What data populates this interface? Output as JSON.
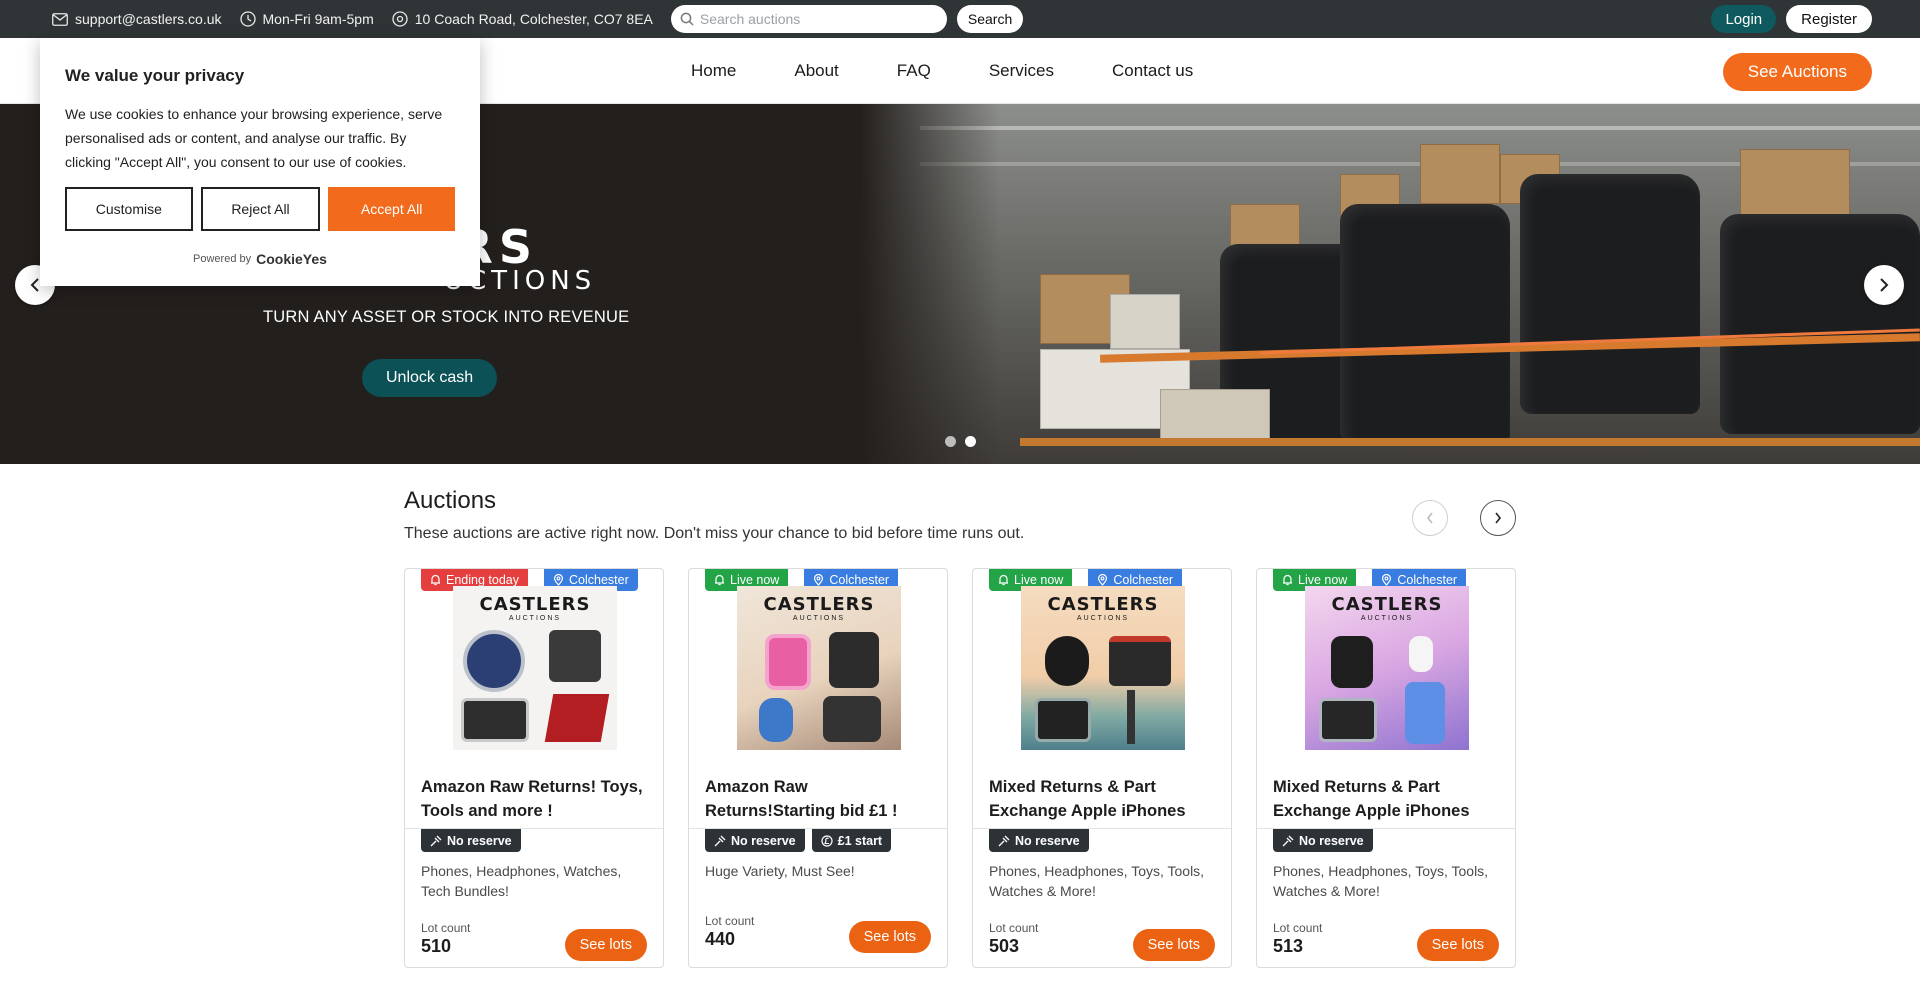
{
  "topbar": {
    "email": "support@castlers.co.uk",
    "hours": "Mon-Fri 9am-5pm",
    "address": "10 Coach Road, Colchester, CO7 8EA",
    "search_placeholder": "Search auctions",
    "search_button": "Search",
    "login": "Login",
    "register": "Register"
  },
  "nav": {
    "links": [
      "Home",
      "About",
      "FAQ",
      "Services",
      "Contact us"
    ],
    "cta": "See Auctions"
  },
  "hero": {
    "logo_main": "ERS",
    "logo_sub": "UCTIONS",
    "tagline": "TURN ANY ASSET OR STOCK INTO REVENUE",
    "button": "Unlock cash",
    "slide_count": 2,
    "active_slide": 2
  },
  "cookie": {
    "title": "We value your privacy",
    "body": "We use cookies to enhance your browsing experience, serve personalised ads or content, and analyse our traffic. By clicking \"Accept All\", you consent to our use of cookies.",
    "customise": "Customise",
    "reject": "Reject All",
    "accept": "Accept All",
    "powered_by": "Powered by",
    "brand": "CookieYes"
  },
  "auctions": {
    "title": "Auctions",
    "subtitle": "These auctions are active right now. Don't miss your chance to bid before time runs out.",
    "cards": [
      {
        "status": "Ending today",
        "location": "Colchester",
        "title": "Amazon Raw Returns! Toys, Tools and more !",
        "chips": [
          "No reserve"
        ],
        "description": "Phones, Headphones, Watches, Tech Bundles!",
        "lot_label": "Lot count",
        "lot_count": "510",
        "button": "See lots"
      },
      {
        "status": "Live now",
        "location": "Colchester",
        "title": "Amazon Raw Returns!Starting bid £1 !",
        "chips": [
          "No reserve",
          "£1 start"
        ],
        "description": "Huge Variety, Must See!",
        "lot_label": "Lot count",
        "lot_count": "440",
        "button": "See lots"
      },
      {
        "status": "Live now",
        "location": "Colchester",
        "title": "Mixed Returns & Part Exchange Apple iPhones",
        "chips": [
          "No reserve"
        ],
        "description": "Phones, Headphones, Toys, Tools, Watches & More!",
        "lot_label": "Lot count",
        "lot_count": "503",
        "button": "See lots"
      },
      {
        "status": "Live now",
        "location": "Colchester",
        "title": "Mixed Returns & Part Exchange Apple iPhones",
        "chips": [
          "No reserve"
        ],
        "description": "Phones, Headphones, Toys, Tools, Watches & More!",
        "lot_label": "Lot count",
        "lot_count": "513",
        "button": "See lots"
      }
    ],
    "thumb_brand": "CASTLERS",
    "thumb_brand_sub": "AUCTIONS"
  },
  "colors": {
    "topbar": "#2f3437",
    "accent_orange": "#f26b1d",
    "teal": "#0e5a5e",
    "ending_red": "#e53e3e",
    "live_green": "#22a447",
    "location_blue": "#3a7de0"
  }
}
